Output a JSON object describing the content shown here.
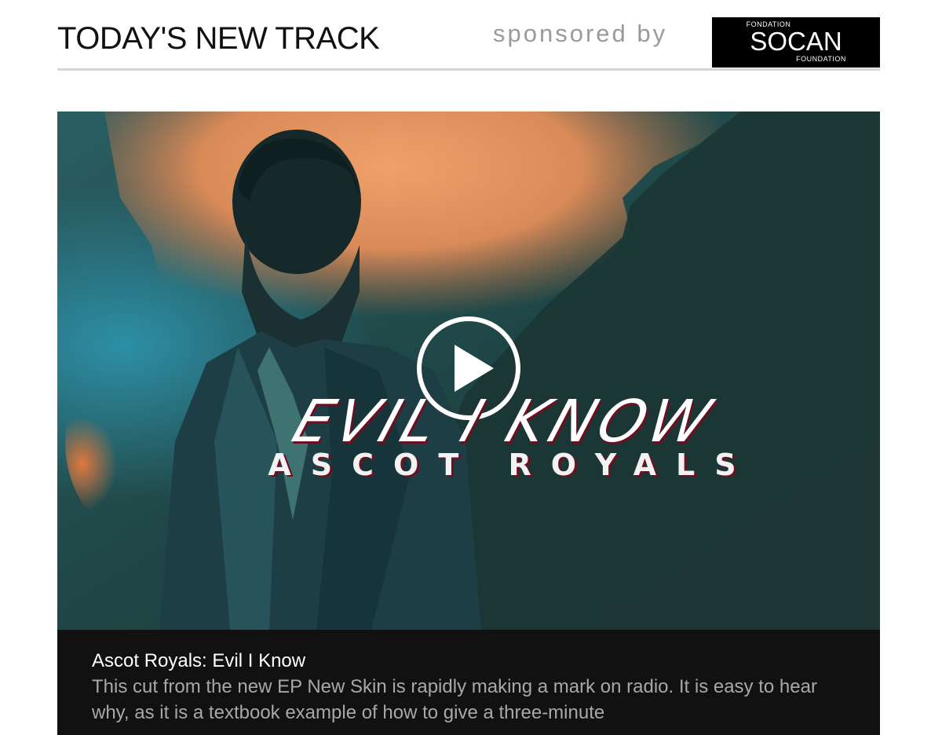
{
  "header": {
    "title": "TODAY'S NEW TRACK",
    "sponsored_label": "sponsored by",
    "sponsor": {
      "top": "FONDATION",
      "name": "SOCAN",
      "bottom": "FOUNDATION"
    }
  },
  "video": {
    "song_art_text": "EVIL I KNOW",
    "artist_art_text": "ASCOT ROYALS",
    "play_icon": "play-icon"
  },
  "caption": {
    "title": "Ascot Royals: Evil I Know",
    "body": "This cut from the new EP New Skin is rapidly making a mark on radio. It is easy to hear why, as it is a textbook example of how to give a three-minute"
  },
  "colors": {
    "caption_bg": "#111111",
    "caption_title": "#ffffff",
    "caption_text": "#a8a8a8",
    "sponsored_text": "#9a9a9a",
    "divider": "#d6d6d6",
    "video_teal": "#1f3a3a",
    "smoke_orange": "#e8955e"
  }
}
